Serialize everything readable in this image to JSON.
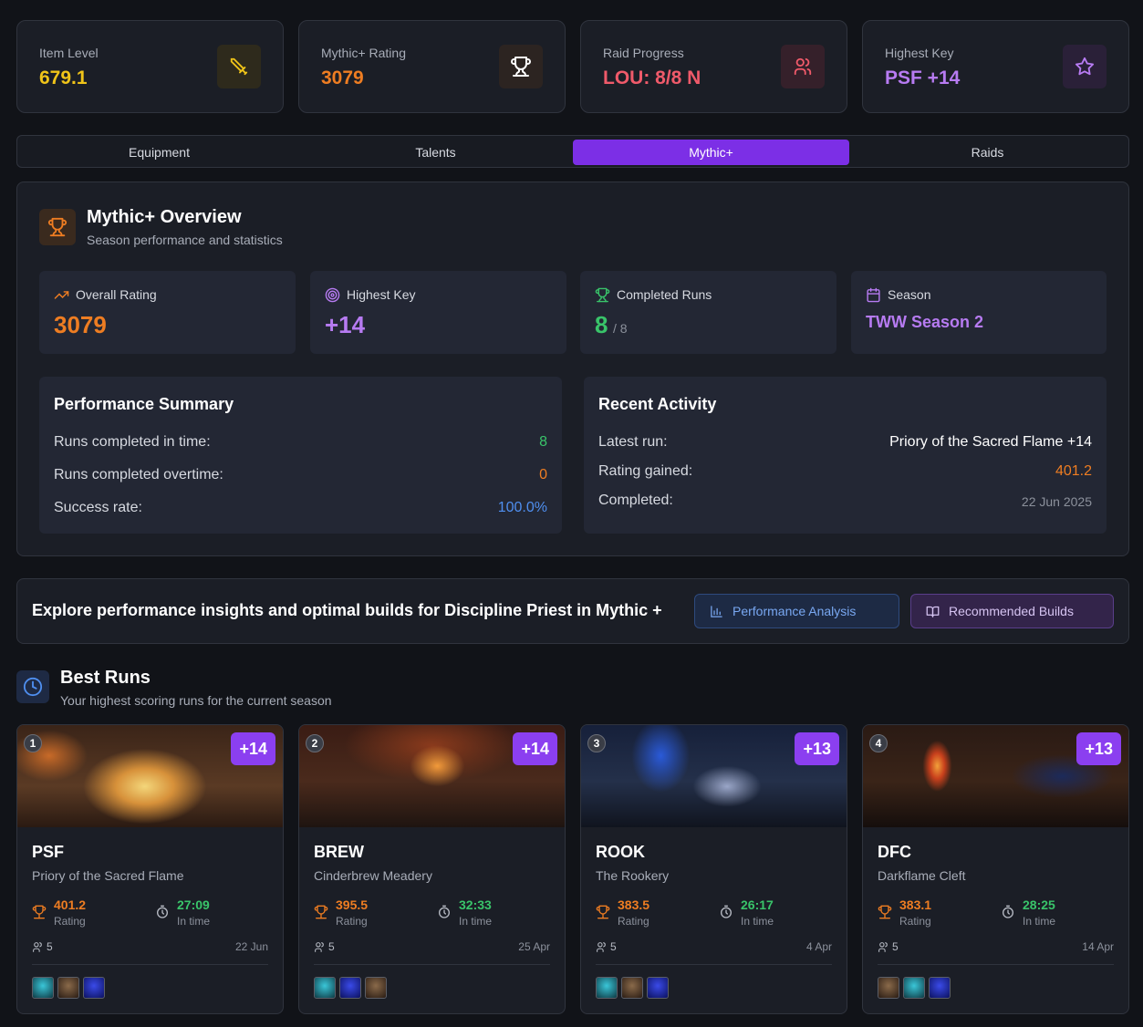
{
  "stats": [
    {
      "label": "Item Level",
      "value": "679.1",
      "color": "#f0c419",
      "icon": "sword-icon",
      "icon_bg": "#2e2a1c"
    },
    {
      "label": "Mythic+ Rating",
      "value": "3079",
      "color": "#ee7d22",
      "icon": "trophy-icon",
      "icon_bg": "#2c2421"
    },
    {
      "label": "Raid Progress",
      "value": "LOU: 8/8 N",
      "color": "#f05a6a",
      "icon": "users-icon",
      "icon_bg": "#35202a"
    },
    {
      "label": "Highest Key",
      "value": "PSF +14",
      "color": "#b77bf2",
      "icon": "star-icon",
      "icon_bg": "#2a2038"
    }
  ],
  "tabs": [
    "Equipment",
    "Talents",
    "Mythic+",
    "Raids"
  ],
  "active_tab": "Mythic+",
  "overview": {
    "title": "Mythic+ Overview",
    "subtitle": "Season performance and statistics",
    "cards": [
      {
        "label": "Overall Rating",
        "value": "3079",
        "color": "#ee7d22",
        "icon": "trending-up-icon"
      },
      {
        "label": "Highest Key",
        "value": "+14",
        "color": "#b77bf2",
        "icon": "target-icon"
      },
      {
        "label": "Completed Runs",
        "value": "8",
        "suffix": "/ 8",
        "color": "#39c46a",
        "icon": "trophy-icon"
      },
      {
        "label": "Season",
        "value": "TWW Season 2",
        "color": "#b77bf2",
        "icon": "calendar-icon"
      }
    ],
    "summary": {
      "title": "Performance Summary",
      "rows": [
        {
          "label": "Runs completed in time:",
          "value": "8",
          "color": "#39c46a"
        },
        {
          "label": "Runs completed overtime:",
          "value": "0",
          "color": "#ee7d22"
        },
        {
          "label": "Success rate:",
          "value": "100.0%",
          "color": "#4f8ff0"
        }
      ]
    },
    "activity": {
      "title": "Recent Activity",
      "rows": [
        {
          "label": "Latest run:",
          "value": "Priory of the Sacred Flame +14",
          "color": "#ffffff"
        },
        {
          "label": "Rating gained:",
          "value": "401.2",
          "color": "#ee7d22"
        },
        {
          "label": "Completed:",
          "value": "22 Jun 2025",
          "color": "#8c919c"
        }
      ]
    }
  },
  "explore": {
    "text": "Explore performance insights and optimal builds for Discipline Priest in Mythic +",
    "perf_button": "Performance Analysis",
    "builds_button": "Recommended Builds"
  },
  "best_runs": {
    "title": "Best Runs",
    "subtitle": "Your highest scoring runs for the current season",
    "rating_label": "Rating",
    "time_label": "In time",
    "runs": [
      {
        "rank": "1",
        "level": "+14",
        "abbr": "PSF",
        "name": "Priory of the Sacred Flame",
        "rating": "401.2",
        "time": "27:09",
        "party": "5",
        "date": "22 Jun",
        "specs": [
          "#1d6f77",
          "#5a3e2b",
          "#1c2a9e"
        ]
      },
      {
        "rank": "2",
        "level": "+14",
        "abbr": "BREW",
        "name": "Cinderbrew Meadery",
        "rating": "395.5",
        "time": "32:33",
        "party": "5",
        "date": "25 Apr",
        "specs": [
          "#1d6f77",
          "#1c2a9e",
          "#5a3e2b"
        ]
      },
      {
        "rank": "3",
        "level": "+13",
        "abbr": "ROOK",
        "name": "The Rookery",
        "rating": "383.5",
        "time": "26:17",
        "party": "5",
        "date": "4 Apr",
        "specs": [
          "#1d6f77",
          "#5a3e2b",
          "#1c2a9e"
        ]
      },
      {
        "rank": "4",
        "level": "+13",
        "abbr": "DFC",
        "name": "Darkflame Cleft",
        "rating": "383.1",
        "time": "28:25",
        "party": "5",
        "date": "14 Apr",
        "specs": [
          "#5a3e2b",
          "#1d6f77",
          "#1c2a9e"
        ]
      }
    ]
  }
}
